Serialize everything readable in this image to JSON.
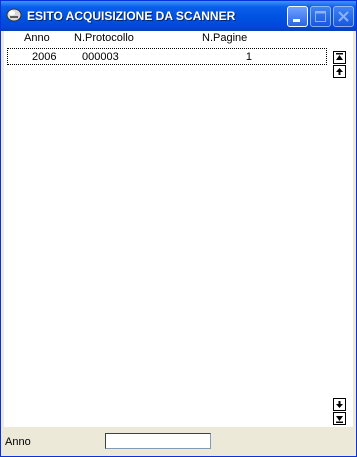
{
  "window": {
    "title": "ESITO ACQUISIZIONE DA SCANNER"
  },
  "table": {
    "columns": [
      "Anno",
      "N.Protocollo",
      "N.Pagine"
    ],
    "rows": [
      {
        "anno": "2006",
        "protocollo": "000003",
        "pagine": "1"
      }
    ]
  },
  "status": {
    "label": "Anno",
    "value": ""
  },
  "icons": {
    "app": "scanner-icon",
    "minimize": "minimize-icon",
    "maximize": "maximize-icon",
    "close": "close-icon",
    "scroll_top": "scroll-top-icon",
    "scroll_up": "scroll-up-icon",
    "scroll_down": "scroll-down-icon",
    "scroll_bottom": "scroll-bottom-icon"
  },
  "colors": {
    "titlebar": "#0054e3",
    "frame": "#ece9d8"
  }
}
